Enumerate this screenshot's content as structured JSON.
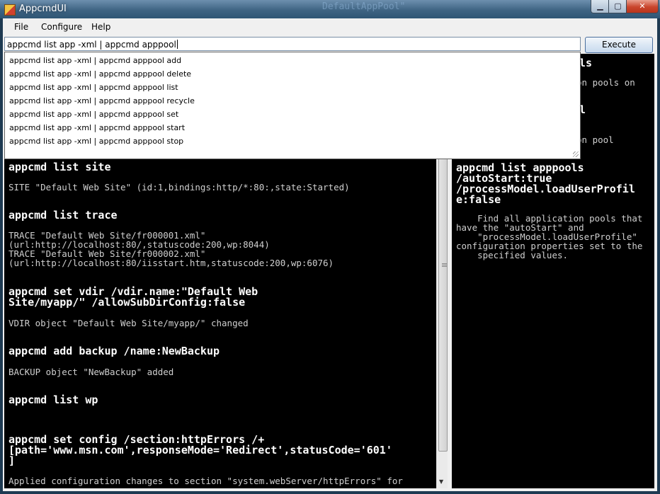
{
  "window": {
    "title": "AppcmdUI",
    "background_text": "DefaultAppPool\"",
    "minimize_glyph": "▁",
    "maximize_glyph": "▢",
    "close_glyph": "✕"
  },
  "menu": [
    "File",
    "Configure",
    "Help"
  ],
  "command_input": {
    "value": "appcmd list app -xml | appcmd apppool"
  },
  "execute_label": "Execute",
  "autocomplete": [
    "appcmd list app -xml | appcmd apppool add",
    "appcmd list app -xml | appcmd apppool delete",
    "appcmd list app -xml | appcmd apppool list",
    "appcmd list app -xml | appcmd apppool recycle",
    "appcmd list app -xml | appcmd apppool set",
    "appcmd list app -xml | appcmd apppool start",
    "appcmd list app -xml | appcmd apppool stop"
  ],
  "output": {
    "entries": [
      {
        "command": "appcmd list site",
        "result": "SITE \"Default Web Site\" (id:1,bindings:http/*:80:,state:Started)"
      },
      {
        "command": "appcmd list trace",
        "result": "TRACE \"Default Web Site/fr000001.xml\"\n(url:http://localhost:80/,statuscode:200,wp:8044)\nTRACE \"Default Web Site/fr000002.xml\"\n(url:http://localhost:80/iisstart.htm,statuscode:200,wp:6076)"
      },
      {
        "command": "appcmd set vdir /vdir.name:\"Default Web\nSite/myapp/\" /allowSubDirConfig:false",
        "result": "VDIR object \"Default Web Site/myapp/\" changed"
      },
      {
        "command": "appcmd add backup /name:NewBackup",
        "result": "BACKUP object \"NewBackup\" added"
      },
      {
        "command": "appcmd list wp",
        "result": ""
      },
      {
        "command": "appcmd set config /section:httpErrors /+\n[path='www.msn.com',responseMode='Redirect',statusCode='601'\n]",
        "result": "Applied configuration changes to section \"system.webServer/httpErrors\" for"
      }
    ]
  },
  "help": {
    "partial_1": "ls",
    "partial_2": "on pools on",
    "partial_3": "l",
    "partial_4": "on pool",
    "example_command": "appcmd list apppools\n/autoStart:true\n/processModel.loadUserProfil\ne:false",
    "example_description": "    Find all application pools that\nhave the \"autoStart\" and\n    \"processModel.loadUserProfile\"\nconfiguration properties set to the\n    specified values."
  },
  "colors": {
    "console_bg": "#000000",
    "console_text": "#cfcfcf",
    "command_text": "#ffffff"
  }
}
